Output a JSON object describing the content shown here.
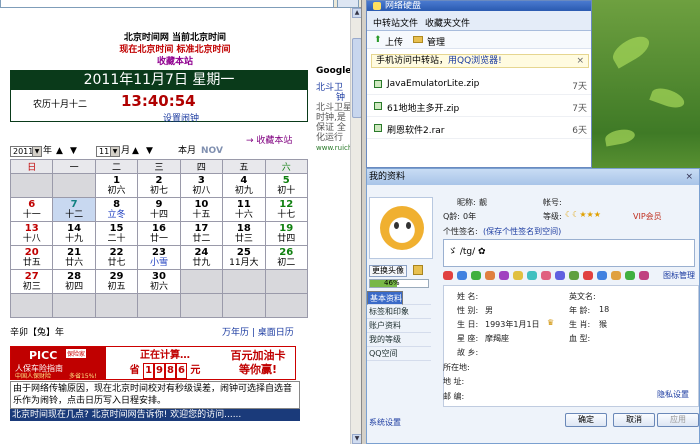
{
  "browser": {
    "header": {
      "line1": "北京时间网 当前北京时间",
      "line2": "现在北京时间 标准北京时间",
      "line3": "收藏本站"
    },
    "date_display": "2011年11月7日 星期一",
    "lunar_date": "农历十月十二",
    "clock": "13:40:54",
    "alarm_link": "设置闹钟",
    "bookmark_link": "→ 收藏本站",
    "controls": {
      "year": "2011",
      "year_suffix": "年",
      "month": "11",
      "month_suffix": "月",
      "month_label": "本月",
      "month_en": "NOV"
    },
    "weekdays": [
      "日",
      "一",
      "二",
      "三",
      "四",
      "五",
      "六"
    ],
    "calendar": [
      [
        null,
        null,
        {
          "d": "1",
          "s": "初六"
        },
        {
          "d": "2",
          "s": "初七"
        },
        {
          "d": "3",
          "s": "初八"
        },
        {
          "d": "4",
          "s": "初九"
        },
        {
          "d": "5",
          "s": "初十"
        }
      ],
      [
        {
          "d": "6",
          "s": "十一"
        },
        {
          "d": "7",
          "s": "十二"
        },
        {
          "d": "8",
          "s": "立冬"
        },
        {
          "d": "9",
          "s": "十四"
        },
        {
          "d": "10",
          "s": "十五"
        },
        {
          "d": "11",
          "s": "十六"
        },
        {
          "d": "12",
          "s": "十七"
        }
      ],
      [
        {
          "d": "13",
          "s": "十八"
        },
        {
          "d": "14",
          "s": "十九"
        },
        {
          "d": "15",
          "s": "二十"
        },
        {
          "d": "16",
          "s": "廿一"
        },
        {
          "d": "17",
          "s": "廿二"
        },
        {
          "d": "18",
          "s": "廿三"
        },
        {
          "d": "19",
          "s": "廿四"
        }
      ],
      [
        {
          "d": "20",
          "s": "廿五"
        },
        {
          "d": "21",
          "s": "廿六"
        },
        {
          "d": "22",
          "s": "廿七"
        },
        {
          "d": "23",
          "s": "小雪"
        },
        {
          "d": "24",
          "s": "廿九"
        },
        {
          "d": "25",
          "s": "11月大"
        },
        {
          "d": "26",
          "s": "初二"
        }
      ],
      [
        {
          "d": "27",
          "s": "初三"
        },
        {
          "d": "28",
          "s": "初四"
        },
        {
          "d": "29",
          "s": "初五"
        },
        {
          "d": "30",
          "s": "初六"
        },
        null,
        null,
        null
      ],
      [
        null,
        null,
        null,
        null,
        null,
        null,
        null
      ]
    ],
    "year_info": "辛卯【兔】年",
    "perpetual_link": "万年历",
    "desktop_link": "桌面日历",
    "ad": {
      "brand": "PICC",
      "brand_sub": "中国人保财险",
      "brand_line": "人保车险指南",
      "brand_tag": "保险家",
      "discount": "多省15%!",
      "calc": "正在计算…",
      "save_prefix": "省",
      "digits": [
        "1",
        "9",
        "8",
        "6"
      ],
      "save_suffix": "元",
      "right_line1": "百元加油卡",
      "right_line2": "等你赢!"
    },
    "notice": "由于网络传输原因，现在北京时间校对有秒级误差，闹钟可选择自选音乐作为闹铃，点击日历写入日程安排。",
    "ticker": "北京时间现在几点? 北京时间网告诉你! 欢迎您的访问......",
    "google": {
      "brand": "Google 提",
      "l1": "北斗卫",
      "l2": "钟",
      "l3": "北斗卫星",
      "l4": "时钟,是",
      "l5": "保证 全",
      "l6": "化运行",
      "url": "www.ruiche"
    }
  },
  "netdisk": {
    "title": "网络硬盘",
    "tabs": [
      "中转站文件",
      "收藏夹文件"
    ],
    "upload": "上传",
    "manage": "管理",
    "hint_prefix": "手机访问中转站，",
    "hint_link": "用QQ浏览器!",
    "files": [
      {
        "name": "JavaEmulatorLite.zip",
        "age": "7天"
      },
      {
        "name": "61地地主多开.zip",
        "age": "7天"
      },
      {
        "name": "刷恩软件2.rar",
        "age": "6天"
      }
    ]
  },
  "qq": {
    "title": "我的资料",
    "nickname_label": "昵称:",
    "nickname": "靓",
    "account_label": "帐号:",
    "qage_label": "Q龄:",
    "qage": "0年",
    "level_label": "等级:",
    "vip": "VIP会员",
    "signature_label": "个性签名:",
    "signature_link": "(保存个性签名到空间)",
    "signature": "ゞ  /tg/  ✿",
    "change_avatar": "更换头像",
    "progress": 0.46,
    "progress_label": "46%",
    "icon_settings": "图标管理",
    "nav": [
      "基本资料",
      "更多资料",
      "标签和印象",
      "账户资料",
      "我的等级",
      "QQ空间"
    ],
    "fields": {
      "name_label": "姓 名:",
      "en_name_label": "英文名:",
      "gender_label": "性 别:",
      "gender": "男",
      "age_label": "年 龄:",
      "age": "18",
      "birthday_label": "生 日:",
      "birthday": "1993年1月1日",
      "zodiac_label": "生 肖:",
      "zodiac": "猴",
      "constellation_label": "星 座:",
      "constellation": "摩羯座",
      "blood_label": "血 型:",
      "hometown_label": "故 乡:",
      "location_label": "所在地:",
      "address_label": "地 址:",
      "postcode_label": "邮 编:"
    },
    "privacy": "隐私设置",
    "system_settings": "系统设置",
    "buttons": {
      "ok": "确定",
      "cancel": "取消",
      "apply": "应用"
    }
  }
}
